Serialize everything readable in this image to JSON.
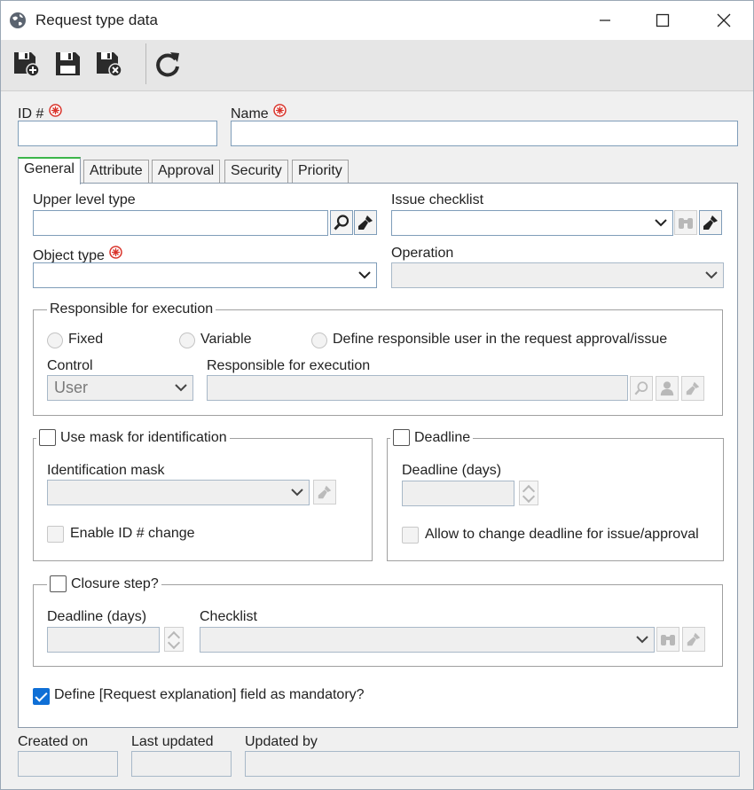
{
  "window": {
    "title": "Request type data",
    "icons": {
      "app": "globe-icon",
      "minimize": "minimize-icon",
      "maximize": "maximize-icon",
      "close": "close-icon"
    }
  },
  "toolbar": {
    "buttons": [
      "save-and-new-icon",
      "save-icon",
      "save-and-close-icon",
      "refresh-icon"
    ]
  },
  "header": {
    "id_label": "ID #",
    "id_value": "",
    "name_label": "Name",
    "name_value": ""
  },
  "tabs": [
    {
      "label": "General",
      "active": true
    },
    {
      "label": "Attribute",
      "active": false
    },
    {
      "label": "Approval",
      "active": false
    },
    {
      "label": "Security",
      "active": false
    },
    {
      "label": "Priority",
      "active": false
    }
  ],
  "general": {
    "upper_level_type_label": "Upper level type",
    "issue_checklist_label": "Issue checklist",
    "object_type_label": "Object type",
    "operation_label": "Operation",
    "responsible": {
      "group_title": "Responsible for execution",
      "options": [
        "Fixed",
        "Variable",
        "Define responsible user in the request approval/issue"
      ],
      "control_label": "Control",
      "control_value": "User",
      "responsible_label": "Responsible for execution"
    },
    "mask": {
      "group_title": "Use mask for identification",
      "mask_label": "Identification mask",
      "enable_change_label": "Enable ID # change"
    },
    "deadline": {
      "group_title": "Deadline",
      "days_label": "Deadline (days)",
      "allow_change_label": "Allow to change deadline for issue/approval"
    },
    "closure": {
      "group_title": "Closure step?",
      "days_label": "Deadline (days)",
      "checklist_label": "Checklist"
    },
    "mandatory_label": "Define [Request explanation] field as mandatory?",
    "mandatory_checked": true
  },
  "footer": {
    "created_on_label": "Created on",
    "last_updated_label": "Last updated",
    "updated_by_label": "Updated by"
  },
  "colors": {
    "accent": "#0f6fd6",
    "tab_active": "#3cb54a",
    "required": "#d9342b"
  }
}
